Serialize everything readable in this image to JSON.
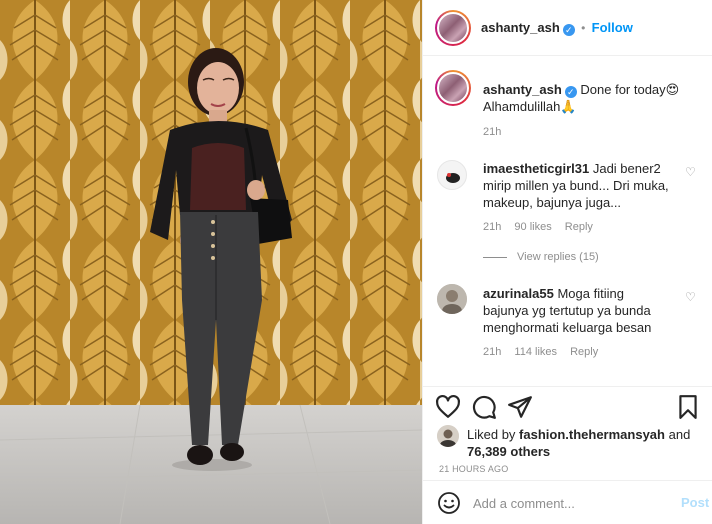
{
  "header": {
    "username": "ashanty_ash",
    "separator": "•",
    "follow_label": "Follow"
  },
  "caption": {
    "username": "ashanty_ash",
    "text_line1": "Done for today😍",
    "text_line2": "Alhamdulillah🙏",
    "time": "21h"
  },
  "comments": [
    {
      "username": "imaestheticgirl31",
      "line1": "Jadi bener2",
      "line2": "mirip millen ya bund... Dri muka,",
      "line3": "makeup, bajunya juga...",
      "time": "21h",
      "likes": "90 likes",
      "reply_label": "Reply",
      "view_replies": "View replies (15)"
    },
    {
      "username": "azurinala55",
      "line1": "Moga fitiing",
      "line2": "bajunya yg tertutup ya bunda",
      "line3": "menghormati keluarga besan",
      "time": "21h",
      "likes": "114 likes",
      "reply_label": "Reply"
    }
  ],
  "likes": {
    "liked_by_prefix": "Liked by",
    "liker": "fashion.thehermansyah",
    "and_label": "and",
    "others": "76,389 others"
  },
  "timestamp": "21 HOURS AGO",
  "add_comment": {
    "placeholder": "Add a comment...",
    "post_label": "Post"
  },
  "colors": {
    "accent": "#0095f6",
    "verified": "#3897f0",
    "muted": "#8e8e8e",
    "wallpaper_gold": "#c8962f",
    "floor": "#c9c7c4"
  },
  "icons": {
    "like": "heart-icon",
    "comment": "comment-icon",
    "share": "paper-plane-icon",
    "save": "bookmark-icon",
    "emoji": "smiley-icon"
  }
}
